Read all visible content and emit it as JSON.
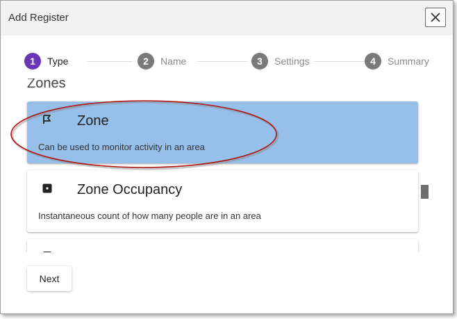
{
  "dialog": {
    "title": "Add Register",
    "close_icon": "close-icon"
  },
  "stepper": {
    "steps": [
      {
        "number": "1",
        "label": "Type",
        "active": true
      },
      {
        "number": "2",
        "label": "Name",
        "active": false
      },
      {
        "number": "3",
        "label": "Settings",
        "active": false
      },
      {
        "number": "4",
        "label": "Summary",
        "active": false
      }
    ]
  },
  "section": {
    "title": "Zones"
  },
  "cards": [
    {
      "title": "Zone",
      "description": "Can be used to monitor activity in an area",
      "icon": "zone-flag-icon",
      "selected": true
    },
    {
      "title": "Zone Occupancy",
      "description": "Instantaneous count of how many people are in an area",
      "icon": "occupancy-square-icon",
      "selected": false
    },
    {
      "title": "",
      "description": "",
      "icon": "partial-icon",
      "selected": false
    }
  ],
  "footer": {
    "next_label": "Next"
  },
  "colors": {
    "accent": "#6a35b8",
    "selected_card": "#96bfea",
    "annotation": "#b01010"
  }
}
